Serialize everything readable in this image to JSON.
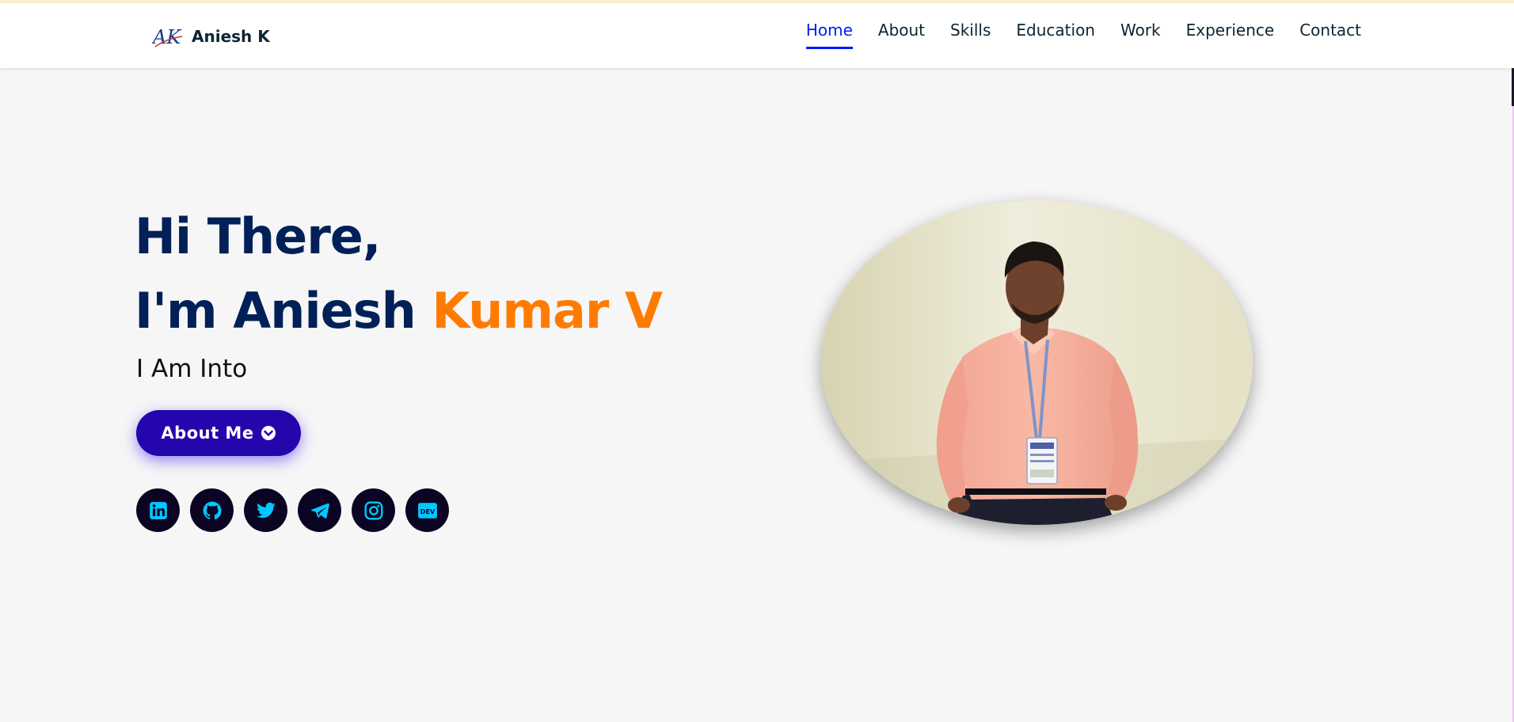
{
  "brand": {
    "logo_text": "AK",
    "name": "Aniesh K"
  },
  "nav": {
    "items": [
      {
        "label": "Home",
        "active": true
      },
      {
        "label": "About",
        "active": false
      },
      {
        "label": "Skills",
        "active": false
      },
      {
        "label": "Education",
        "active": false
      },
      {
        "label": "Work",
        "active": false
      },
      {
        "label": "Experience",
        "active": false
      },
      {
        "label": "Contact",
        "active": false
      }
    ]
  },
  "hero": {
    "greeting": "Hi There,",
    "intro_prefix": "I'm Aniesh",
    "intro_highlight": "Kumar V",
    "subtitle": "I Am Into",
    "cta_label": "About Me",
    "cta_icon": "chevron-circle-down-icon"
  },
  "socials": [
    {
      "icon": "linkedin-icon"
    },
    {
      "icon": "github-icon"
    },
    {
      "icon": "twitter-icon"
    },
    {
      "icon": "telegram-icon"
    },
    {
      "icon": "instagram-icon"
    },
    {
      "icon": "dev-icon",
      "glyph_text": "DEV"
    }
  ],
  "colors": {
    "primary_text": "#002057",
    "accent": "#ff7b00",
    "nav_active": "#011aff",
    "button": "#2506ad",
    "social_bg": "#0b0523",
    "social_icon": "#00c8ff",
    "page_bg": "#f6f6f6"
  }
}
